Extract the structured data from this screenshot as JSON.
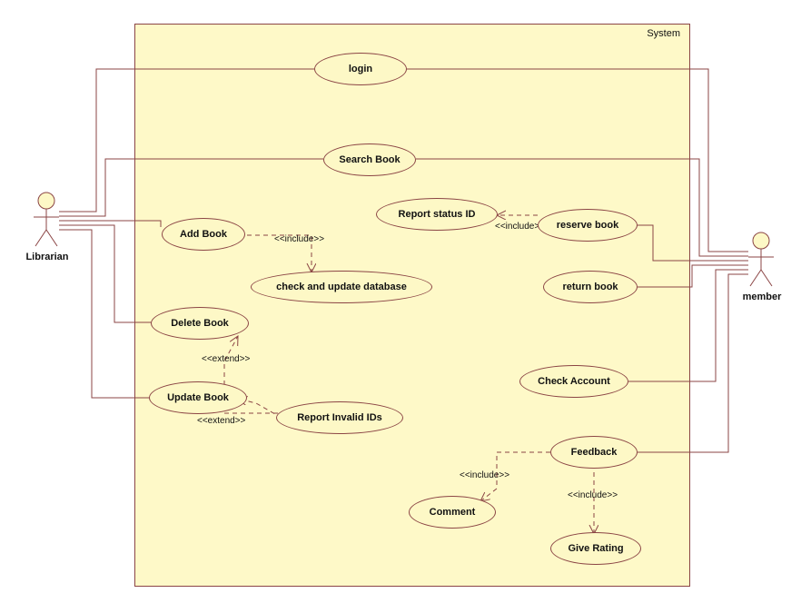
{
  "chart_data": {
    "type": "uml-use-case",
    "system": "System",
    "actors": [
      "Librarian",
      "member"
    ],
    "use_cases": [
      {
        "id": "login",
        "label": "login"
      },
      {
        "id": "search_book",
        "label": "Search Book"
      },
      {
        "id": "report_status_id",
        "label": "Report status ID"
      },
      {
        "id": "reserve_book",
        "label": "reserve book"
      },
      {
        "id": "add_book",
        "label": "Add Book"
      },
      {
        "id": "check_update_db",
        "label": "check and update database"
      },
      {
        "id": "return_book",
        "label": "return book"
      },
      {
        "id": "delete_book",
        "label": "Delete Book"
      },
      {
        "id": "update_book",
        "label": "Update Book"
      },
      {
        "id": "check_account",
        "label": "Check Account"
      },
      {
        "id": "report_invalid_ids",
        "label": "Report Invalid IDs"
      },
      {
        "id": "feedback",
        "label": "Feedback"
      },
      {
        "id": "comment",
        "label": "Comment"
      },
      {
        "id": "give_rating",
        "label": "Give Rating"
      }
    ],
    "associations": [
      {
        "actor": "Librarian",
        "usecase": "login"
      },
      {
        "actor": "Librarian",
        "usecase": "search_book"
      },
      {
        "actor": "Librarian",
        "usecase": "add_book"
      },
      {
        "actor": "Librarian",
        "usecase": "delete_book"
      },
      {
        "actor": "Librarian",
        "usecase": "update_book"
      },
      {
        "actor": "member",
        "usecase": "login"
      },
      {
        "actor": "member",
        "usecase": "search_book"
      },
      {
        "actor": "member",
        "usecase": "reserve_book"
      },
      {
        "actor": "member",
        "usecase": "return_book"
      },
      {
        "actor": "member",
        "usecase": "check_account"
      },
      {
        "actor": "member",
        "usecase": "feedback"
      }
    ],
    "dependencies": [
      {
        "from": "add_book",
        "to": "check_update_db",
        "stereotype": "<<include>>"
      },
      {
        "from": "reserve_book",
        "to": "report_status_id",
        "stereotype": "<<include>>"
      },
      {
        "from": "report_invalid_ids",
        "to": "delete_book",
        "stereotype": "<<extend>>"
      },
      {
        "from": "report_invalid_ids",
        "to": "update_book",
        "stereotype": "<<extend>>"
      },
      {
        "from": "feedback",
        "to": "comment",
        "stereotype": "<<include>>"
      },
      {
        "from": "feedback",
        "to": "give_rating",
        "stereotype": "<<include>>"
      }
    ]
  },
  "system": {
    "title": "System"
  },
  "actors": {
    "librarian": "Librarian",
    "member": "member"
  },
  "uc": {
    "login": "login",
    "search_book": "Search Book",
    "report_status_id": "Report status ID",
    "reserve_book": "reserve book",
    "add_book": "Add Book",
    "check_update_db": "check and update database",
    "return_book": "return book",
    "delete_book": "Delete Book",
    "update_book": "Update Book",
    "check_account": "Check Account",
    "report_invalid_ids": "Report Invalid IDs",
    "feedback": "Feedback",
    "comment": "Comment",
    "give_rating": "Give Rating"
  },
  "rel": {
    "include": "<<include>>",
    "extend": "<<extend>>"
  }
}
